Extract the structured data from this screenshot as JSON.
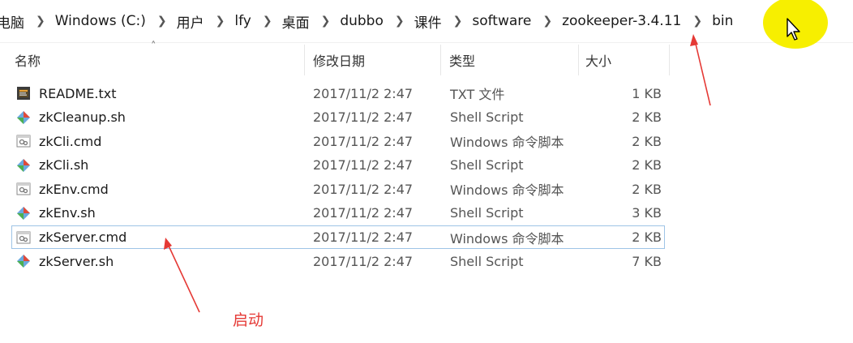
{
  "breadcrumb": [
    "电脑",
    "Windows (C:)",
    "用户",
    "lfy",
    "桌面",
    "dubbo",
    "课件",
    "software",
    "zookeeper-3.4.11",
    "bin"
  ],
  "columns": {
    "name": "名称",
    "date": "修改日期",
    "type": "类型",
    "size": "大小"
  },
  "files": [
    {
      "name": "README.txt",
      "date": "2017/11/2 2:47",
      "type": "TXT 文件",
      "size": "1 KB",
      "icon": "text-file-icon"
    },
    {
      "name": "zkCleanup.sh",
      "date": "2017/11/2 2:47",
      "type": "Shell Script",
      "size": "2 KB",
      "icon": "shell-script-icon"
    },
    {
      "name": "zkCli.cmd",
      "date": "2017/11/2 2:47",
      "type": "Windows 命令脚本",
      "size": "2 KB",
      "icon": "cmd-file-icon"
    },
    {
      "name": "zkCli.sh",
      "date": "2017/11/2 2:47",
      "type": "Shell Script",
      "size": "2 KB",
      "icon": "shell-script-icon"
    },
    {
      "name": "zkEnv.cmd",
      "date": "2017/11/2 2:47",
      "type": "Windows 命令脚本",
      "size": "2 KB",
      "icon": "cmd-file-icon"
    },
    {
      "name": "zkEnv.sh",
      "date": "2017/11/2 2:47",
      "type": "Shell Script",
      "size": "3 KB",
      "icon": "shell-script-icon"
    },
    {
      "name": "zkServer.cmd",
      "date": "2017/11/2 2:47",
      "type": "Windows 命令脚本",
      "size": "2 KB",
      "icon": "cmd-file-icon"
    },
    {
      "name": "zkServer.sh",
      "date": "2017/11/2 2:47",
      "type": "Shell Script",
      "size": "7 KB",
      "icon": "shell-script-icon"
    }
  ],
  "selected_file": "zkServer.cmd",
  "annotation": "启动",
  "colors": {
    "annotation": "#e53935",
    "cursor_highlight": "#f7ef00",
    "selection_border": "#9ec4e6"
  }
}
